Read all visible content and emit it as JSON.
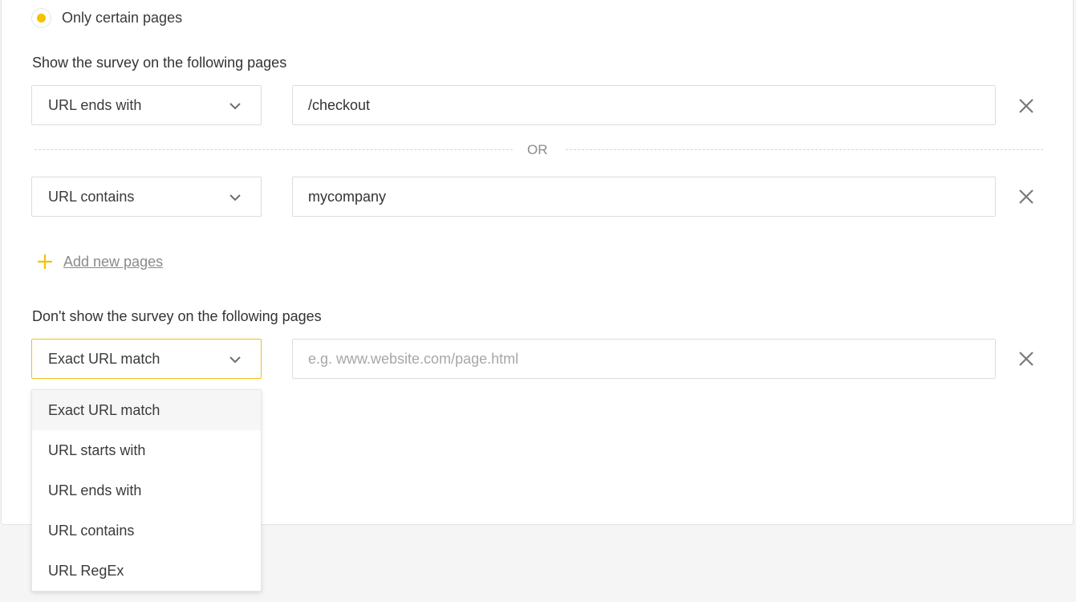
{
  "visibility": {
    "option_label": "Only certain pages",
    "selected": true
  },
  "show_section": {
    "title": "Show the survey on the following pages",
    "rules": [
      {
        "match_type": "URL ends with",
        "value": "/checkout"
      },
      {
        "match_type": "URL contains",
        "value": "mycompany"
      }
    ],
    "separator": "OR",
    "add_label": "Add new pages"
  },
  "hide_section": {
    "title": "Don't show the survey on the following pages",
    "rule": {
      "match_type": "Exact URL match",
      "value": "",
      "placeholder": "e.g. www.website.com/page.html"
    },
    "dropdown_open": true,
    "dropdown_options": [
      "Exact URL match",
      "URL starts with",
      "URL ends with",
      "URL contains",
      "URL RegEx"
    ],
    "hovered_option": "Exact URL match"
  },
  "colors": {
    "accent": "#f5c000",
    "active_border": "#f0be1a",
    "hover_bg": "#f6f6f7"
  },
  "icons": [
    "radio-selected-icon",
    "chevron-down-icon",
    "close-icon",
    "plus-icon"
  ]
}
